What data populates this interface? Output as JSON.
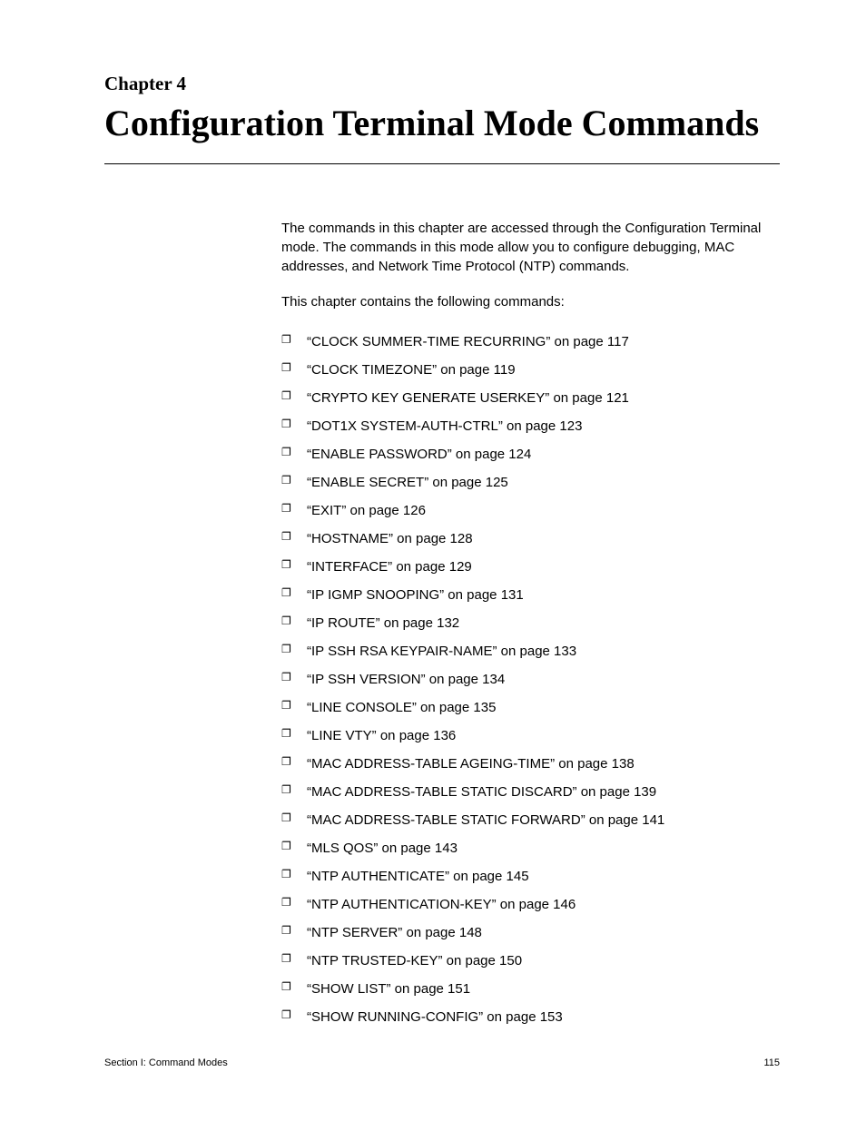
{
  "chapter": {
    "label": "Chapter 4",
    "title": "Configuration Terminal Mode Commands"
  },
  "intro": {
    "para1": "The commands in this chapter are accessed through the Configuration Terminal mode. The commands in this mode allow you to configure debugging, MAC addresses, and Network Time Protocol (NTP) commands.",
    "para2": "This chapter contains the following commands:"
  },
  "commands": [
    "“CLOCK SUMMER-TIME RECURRING” on page 117",
    "“CLOCK TIMEZONE” on page 119",
    "“CRYPTO KEY GENERATE USERKEY” on page 121",
    "“DOT1X SYSTEM-AUTH-CTRL” on page 123",
    "“ENABLE PASSWORD” on page 124",
    "“ENABLE SECRET” on page 125",
    "“EXIT” on page 126",
    "“HOSTNAME” on page 128",
    "“INTERFACE” on page 129",
    "“IP IGMP SNOOPING” on page 131",
    "“IP ROUTE” on page 132",
    "“IP SSH RSA KEYPAIR-NAME” on page 133",
    "“IP SSH VERSION” on page 134",
    "“LINE CONSOLE” on page 135",
    "“LINE VTY” on page 136",
    "“MAC ADDRESS-TABLE AGEING-TIME” on page 138",
    "“MAC ADDRESS-TABLE STATIC DISCARD” on page 139",
    "“MAC ADDRESS-TABLE STATIC FORWARD” on page 141",
    "“MLS QOS” on page 143",
    "“NTP AUTHENTICATE” on page 145",
    "“NTP AUTHENTICATION-KEY” on page 146",
    "“NTP SERVER” on page 148",
    "“NTP TRUSTED-KEY” on page 150",
    "“SHOW LIST” on page 151",
    "“SHOW RUNNING-CONFIG” on page 153"
  ],
  "footer": {
    "section": "Section I: Command Modes",
    "page": "115"
  }
}
